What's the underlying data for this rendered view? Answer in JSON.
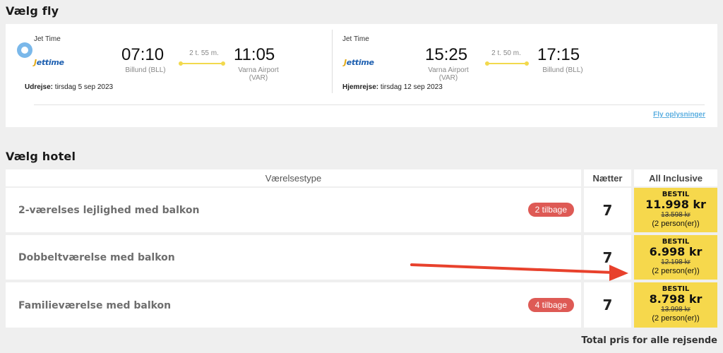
{
  "flights": {
    "title": "Vælg fly",
    "outbound": {
      "airline": "Jet Time",
      "logo": "Jettime",
      "dep_time": "07:10",
      "dep_place": "Billund (BLL)",
      "duration": "2 t. 55 m.",
      "arr_time": "11:05",
      "arr_place_line1": "Varna Airport",
      "arr_place_line2": "(VAR)",
      "date_label": "Udrejse:",
      "date": "tirsdag 5 sep 2023"
    },
    "return": {
      "airline": "Jet Time",
      "logo": "Jettime",
      "dep_time": "15:25",
      "dep_place_line1": "Varna Airport",
      "dep_place_line2": "(VAR)",
      "duration": "2 t. 50 m.",
      "arr_time": "17:15",
      "arr_place": "Billund (BLL)",
      "date_label": "Hjemrejse:",
      "date": "tirsdag 12 sep 2023"
    },
    "info_link": "Fly oplysninger"
  },
  "hotel": {
    "title": "Vælg hotel",
    "headers": {
      "room_type": "Værelsestype",
      "nights": "Nætter",
      "board": "All Inclusive"
    },
    "rows": [
      {
        "name": "2-værelses lejlighed med balkon",
        "badge": "2 tilbage",
        "nights": "7",
        "bestil": "BESTIL",
        "price": "11.998 kr",
        "old_price": "13.598 kr",
        "persons": "(2 person(er))"
      },
      {
        "name": "Dobbeltværelse med balkon",
        "badge": "",
        "nights": "7",
        "bestil": "BESTIL",
        "price": "6.998 kr",
        "old_price": "12.198 kr",
        "persons": "(2 person(er))"
      },
      {
        "name": "Familieværelse med balkon",
        "badge": "4 tilbage",
        "nights": "7",
        "bestil": "BESTIL",
        "price": "8.798 kr",
        "old_price": "13.998 kr",
        "persons": "(2 person(er))"
      }
    ],
    "total_label": "Total pris for alle rejsende"
  },
  "colors": {
    "accent_yellow": "#f6d84c",
    "badge_red": "#de5a55",
    "link_blue": "#5aaee0",
    "annotation_arrow": "#e8412c"
  }
}
